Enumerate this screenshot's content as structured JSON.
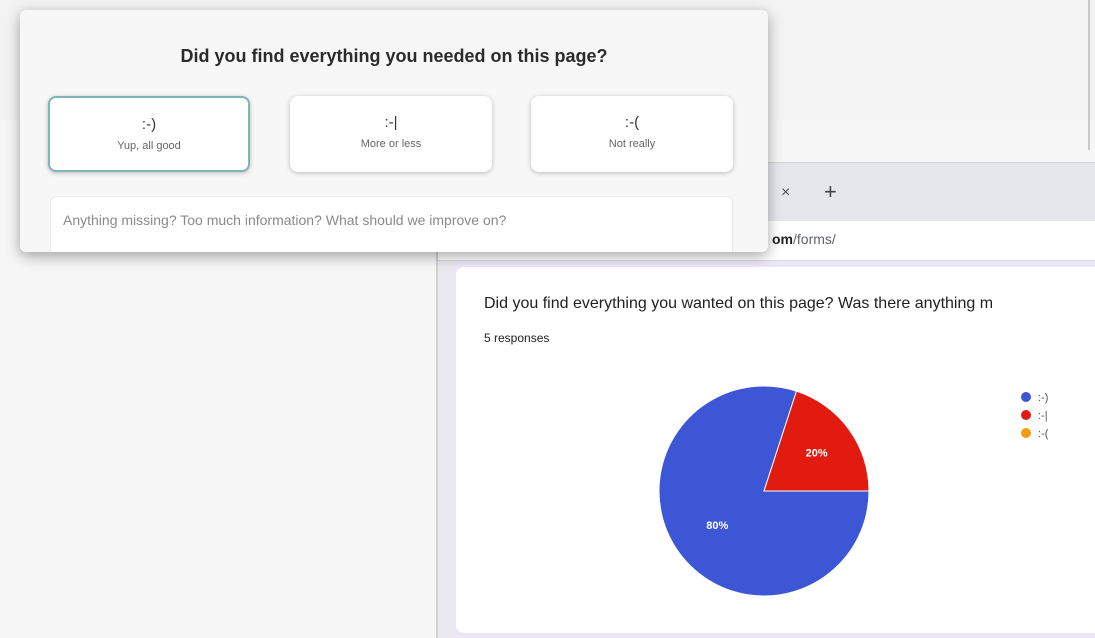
{
  "feedback": {
    "heading": "Did you find everything you needed on this page?",
    "options": [
      {
        "face": ":-)",
        "label": "Yup, all good",
        "selected": true
      },
      {
        "face": ":-|",
        "label": "More or less",
        "selected": false
      },
      {
        "face": ":-(",
        "label": "Not really",
        "selected": false
      }
    ],
    "input_placeholder": "Anything missing? Too much information? What should we improve on?"
  },
  "browser": {
    "tab_close": "×",
    "new_tab": "+",
    "url_domain": "om",
    "url_path": "/forms/"
  },
  "forms": {
    "question": "Did you find everything you wanted on this page? Was there anything m",
    "responses": "5 responses"
  },
  "chart_data": {
    "type": "pie",
    "title": "",
    "series": [
      {
        "name": ":-)",
        "value": 80,
        "label": "80%",
        "color": "#3c56d6"
      },
      {
        "name": ":-|",
        "value": 20,
        "label": "20%",
        "color": "#e21b10"
      },
      {
        "name": ":-(",
        "value": 0,
        "label": "",
        "color": "#f39c12"
      }
    ],
    "legend": "top-right"
  }
}
